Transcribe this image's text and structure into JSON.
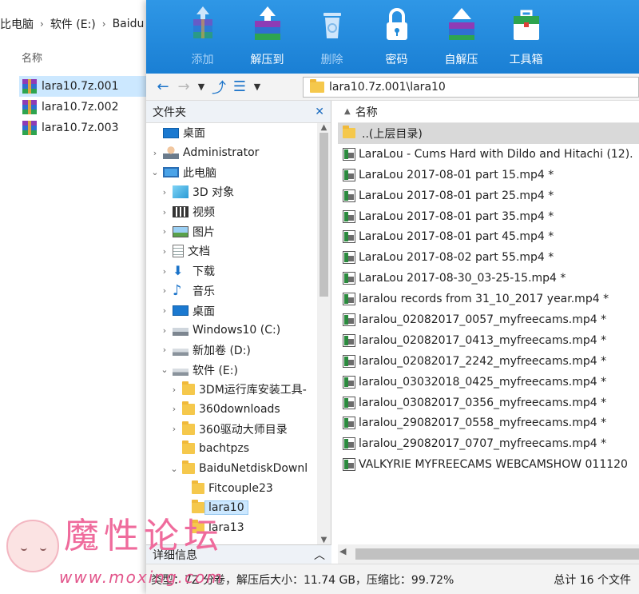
{
  "background_explorer": {
    "breadcrumb": [
      "比电脑",
      "软件 (E:)",
      "Baidu"
    ],
    "column_header": "名称",
    "files": [
      {
        "name": "lara10.7z.001",
        "selected": true
      },
      {
        "name": "lara10.7z.002",
        "selected": false
      },
      {
        "name": "lara10.7z.003",
        "selected": false
      }
    ]
  },
  "toolbar": {
    "buttons": [
      {
        "label": "添加",
        "icon": "add-archive-icon",
        "enabled": false
      },
      {
        "label": "解压到",
        "icon": "extract-icon",
        "enabled": true
      },
      {
        "label": "删除",
        "icon": "recycle-bin-icon",
        "enabled": false
      },
      {
        "label": "密码",
        "icon": "lock-icon",
        "enabled": true
      },
      {
        "label": "自解压",
        "icon": "self-extract-icon",
        "enabled": true
      },
      {
        "label": "工具箱",
        "icon": "toolbox-icon",
        "enabled": true
      }
    ]
  },
  "address_bar": {
    "path": "lara10.7z.001\\lara10"
  },
  "folder_pane": {
    "header": "文件夹",
    "close_symbol": "✕",
    "nodes": [
      {
        "label": "桌面",
        "level": 0,
        "arrow": "",
        "icon": "desktop-icon"
      },
      {
        "label": "Administrator",
        "level": 0,
        "arrow": "›",
        "icon": "user-icon"
      },
      {
        "label": "此电脑",
        "level": 0,
        "arrow": "⌄",
        "icon": "computer-icon"
      },
      {
        "label": "3D 对象",
        "level": 1,
        "arrow": "›",
        "icon": "3d-objects-icon"
      },
      {
        "label": "视频",
        "level": 1,
        "arrow": "›",
        "icon": "video-folder-icon"
      },
      {
        "label": "图片",
        "level": 1,
        "arrow": "›",
        "icon": "pictures-folder-icon"
      },
      {
        "label": "文档",
        "level": 1,
        "arrow": "›",
        "icon": "documents-folder-icon"
      },
      {
        "label": "下载",
        "level": 1,
        "arrow": "›",
        "icon": "download-arrow-icon"
      },
      {
        "label": "音乐",
        "level": 1,
        "arrow": "›",
        "icon": "music-note-icon"
      },
      {
        "label": "桌面",
        "level": 1,
        "arrow": "›",
        "icon": "desktop-icon"
      },
      {
        "label": "Windows10 (C:)",
        "level": 1,
        "arrow": "›",
        "icon": "system-drive-icon"
      },
      {
        "label": "新加卷 (D:)",
        "level": 1,
        "arrow": "›",
        "icon": "drive-icon"
      },
      {
        "label": "软件 (E:)",
        "level": 1,
        "arrow": "⌄",
        "icon": "drive-icon"
      },
      {
        "label": "3DM运行库安装工具-",
        "level": 2,
        "arrow": "›",
        "icon": "folder-icon"
      },
      {
        "label": "360downloads",
        "level": 2,
        "arrow": "›",
        "icon": "folder-icon"
      },
      {
        "label": "360驱动大师目录",
        "level": 2,
        "arrow": "›",
        "icon": "folder-icon"
      },
      {
        "label": "bachtpzs",
        "level": 2,
        "arrow": "",
        "icon": "folder-icon"
      },
      {
        "label": "BaiduNetdiskDownl",
        "level": 2,
        "arrow": "⌄",
        "icon": "folder-icon"
      },
      {
        "label": "Fitcouple23",
        "level": 3,
        "arrow": "",
        "icon": "folder-icon"
      },
      {
        "label": "lara10",
        "level": 3,
        "arrow": "",
        "icon": "folder-icon",
        "selected": true
      },
      {
        "label": "lara13",
        "level": 3,
        "arrow": "",
        "icon": "folder-icon"
      }
    ],
    "detail_label": "详细信息",
    "detail_chevron": "︿"
  },
  "file_list": {
    "header": "名称",
    "header_caret": "▲",
    "rows": [
      {
        "name": "..(上层目录)",
        "icon": "folder-icon",
        "selected": true
      },
      {
        "name": "LaraLou - Cums Hard with Dildo and Hitachi (12).",
        "icon": "video-file-icon"
      },
      {
        "name": "LaraLou 2017-08-01 part 15.mp4 *",
        "icon": "video-file-icon"
      },
      {
        "name": "LaraLou 2017-08-01 part 25.mp4 *",
        "icon": "video-file-icon"
      },
      {
        "name": "LaraLou 2017-08-01 part 35.mp4 *",
        "icon": "video-file-icon"
      },
      {
        "name": "LaraLou 2017-08-01 part 45.mp4 *",
        "icon": "video-file-icon"
      },
      {
        "name": "LaraLou 2017-08-02 part 55.mp4 *",
        "icon": "video-file-icon"
      },
      {
        "name": "LaraLou 2017-08-30_03-25-15.mp4 *",
        "icon": "video-file-icon"
      },
      {
        "name": "laralou records from 31_10_2017 year.mp4 *",
        "icon": "video-file-icon"
      },
      {
        "name": "laralou_02082017_0057_myfreecams.mp4 *",
        "icon": "video-file-icon"
      },
      {
        "name": "laralou_02082017_0413_myfreecams.mp4 *",
        "icon": "video-file-icon"
      },
      {
        "name": "laralou_02082017_2242_myfreecams.mp4 *",
        "icon": "video-file-icon"
      },
      {
        "name": "laralou_03032018_0425_myfreecams.mp4 *",
        "icon": "video-file-icon"
      },
      {
        "name": "laralou_03082017_0356_myfreecams.mp4 *",
        "icon": "video-file-icon"
      },
      {
        "name": "laralou_29082017_0558_myfreecams.mp4 *",
        "icon": "video-file-icon"
      },
      {
        "name": "laralou_29082017_0707_myfreecams.mp4 *",
        "icon": "video-file-icon"
      },
      {
        "name": "VALKYRIE MYFREECAMS WEBCAMSHOW 011120",
        "icon": "video-file-icon"
      }
    ]
  },
  "status_bar": {
    "left": "类型：7Z 分卷，解压后大小：11.74 GB，压缩比：99.72%",
    "right": "总计 16 个文件"
  },
  "watermark": {
    "title": "魔性论坛",
    "url": "www.moxing.com"
  },
  "colors": {
    "toolbar_blue": "#1f8ad9",
    "selection": "#cce8ff",
    "folder_yellow": "#f5c84c",
    "watermark_pink": "#ef6b9c"
  }
}
